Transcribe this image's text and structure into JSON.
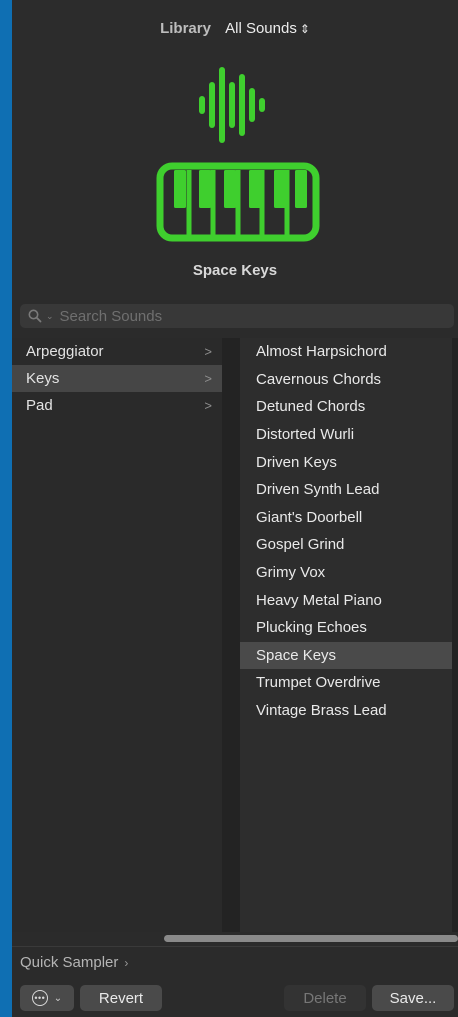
{
  "header": {
    "library_label": "Library",
    "sound_filter": "All Sounds",
    "art_icon": "piano-keyboard-with-waveform",
    "accent_color": "#3fcf2e",
    "preset_name": "Space Keys"
  },
  "search": {
    "placeholder": "Search Sounds"
  },
  "categories": [
    {
      "label": "Arpeggiator",
      "selected": false
    },
    {
      "label": "Keys",
      "selected": true
    },
    {
      "label": "Pad",
      "selected": false
    }
  ],
  "sounds": [
    {
      "label": "Almost Harpsichord",
      "selected": false
    },
    {
      "label": "Cavernous Chords",
      "selected": false
    },
    {
      "label": "Detuned Chords",
      "selected": false
    },
    {
      "label": "Distorted Wurli",
      "selected": false
    },
    {
      "label": "Driven Keys",
      "selected": false
    },
    {
      "label": "Driven Synth Lead",
      "selected": false
    },
    {
      "label": "Giant's Doorbell",
      "selected": false
    },
    {
      "label": "Gospel Grind",
      "selected": false
    },
    {
      "label": "Grimy Vox",
      "selected": false
    },
    {
      "label": "Heavy Metal Piano",
      "selected": false
    },
    {
      "label": "Plucking Echoes",
      "selected": false
    },
    {
      "label": "Space Keys",
      "selected": true
    },
    {
      "label": "Trumpet Overdrive",
      "selected": false
    },
    {
      "label": "Vintage Brass Lead",
      "selected": false
    }
  ],
  "plugin": {
    "label": "Quick Sampler"
  },
  "footer": {
    "revert_label": "Revert",
    "delete_label": "Delete",
    "save_label": "Save..."
  }
}
